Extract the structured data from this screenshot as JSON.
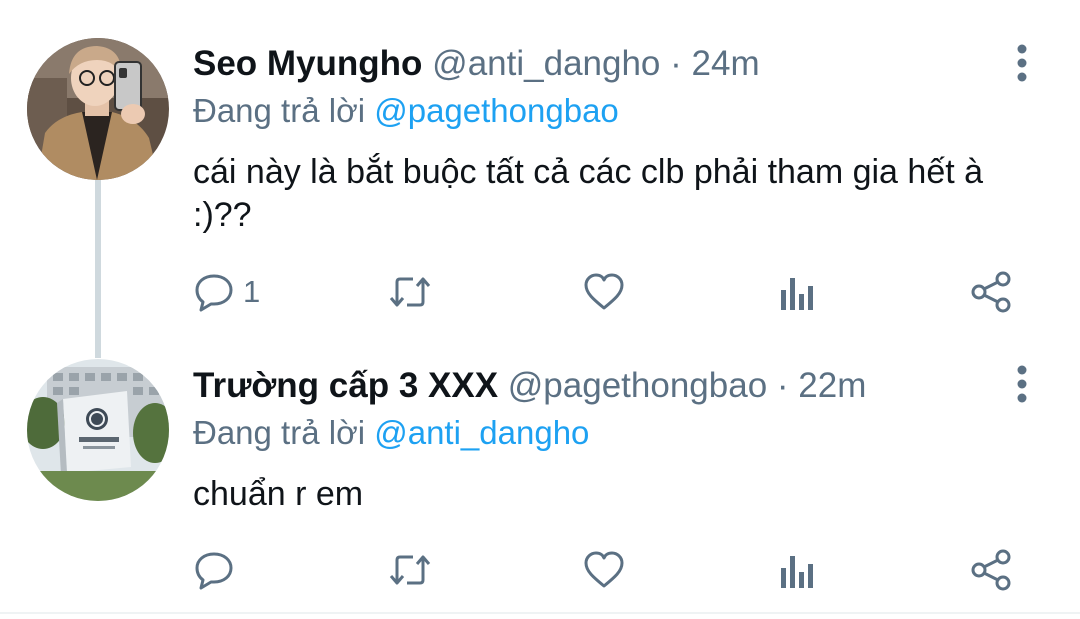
{
  "tweets": [
    {
      "display_name": "Seo Myungho",
      "handle": "@anti_dangho",
      "separator": "·",
      "time": "24m",
      "reply_prefix": "Đang trả lời",
      "reply_to": "@pagethongbao",
      "text": "cái này là bắt buộc tất cả các clb phải tham gia hết à :)??",
      "reply_count": "1",
      "avatar": "person-selfie-photo"
    },
    {
      "display_name": "Trường cấp 3 XXX",
      "handle": "@pagethongbao",
      "separator": "·",
      "time": "22m",
      "reply_prefix": "Đang trả lời",
      "reply_to": "@anti_dangho",
      "text": "chuẩn r em",
      "reply_count": "",
      "avatar": "school-building-photo"
    }
  ],
  "icons": {
    "reply": "reply-icon",
    "retweet": "retweet-icon",
    "like": "heart-icon",
    "analytics": "analytics-icon",
    "share": "share-icon",
    "more": "more-vertical-icon"
  },
  "colors": {
    "text": "#0f1419",
    "secondary": "#5b7083",
    "link": "#1da1f2",
    "thread_line": "#cfd9de"
  }
}
